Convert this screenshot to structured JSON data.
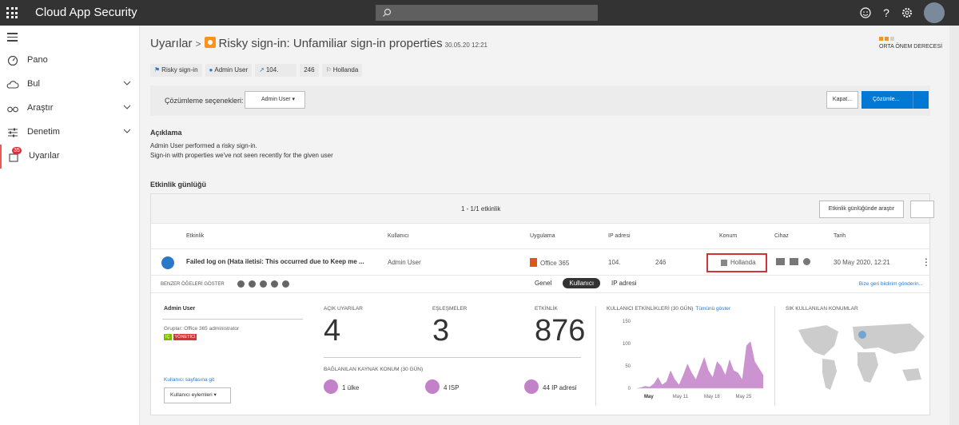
{
  "app": {
    "title": "Cloud App Security"
  },
  "sidebar": {
    "items": [
      {
        "label": "Pano"
      },
      {
        "label": "Bul"
      },
      {
        "label": "Araştır"
      },
      {
        "label": "Denetim"
      },
      {
        "label": "Uyarılar",
        "badge": "35"
      }
    ]
  },
  "header": {
    "breadcrumb": "Uyarılar",
    "title": "Risky sign-in: Unfamiliar sign-in properties",
    "time": "30.05.20 12:21",
    "severity": "ORTA ÖNEM DERECESİ"
  },
  "chips": [
    {
      "text": "Risky sign-in"
    },
    {
      "text": "Admin User"
    },
    {
      "text": "104."
    },
    {
      "text": "246"
    },
    {
      "text": "Hollanda"
    }
  ],
  "resolve": {
    "label": "Çözümleme seçenekleri:",
    "user_select": "Admin User",
    "close": "Kapat...",
    "resolve": "Çözümle..."
  },
  "description": {
    "heading": "Açıklama",
    "line1": "Admin User performed a risky sign-in.",
    "line2": "Sign-in with properties we've not seen recently for the given user"
  },
  "log": {
    "heading": "Etkinlik günlüğü",
    "count": "1 - 1/1 etkinlik",
    "investigate": "Etkinlik günlüğünde araştır",
    "columns": [
      "Etkinlik",
      "Kullanıcı",
      "Uygulama",
      "IP adresi",
      "Konum",
      "Cihaz",
      "Tarih"
    ],
    "row": {
      "activity": "Failed log on (Hata iletisi: This occurred due to Keep me ...",
      "user": "Admin User",
      "app": "Office 365",
      "ip1": "104.",
      "ip2": "246",
      "location": "Hollanda",
      "date": "30 May 2020, 12:21"
    }
  },
  "detail": {
    "similar_label": "BENZER ÖĞELERİ GÖSTER",
    "tabs": [
      "Genel",
      "Kullanıcı",
      "IP adresi"
    ],
    "feedback": "Bize geri bildirim gönderin...",
    "user_name": "Admin User",
    "groups": "Gruplar: Office 365 administrator",
    "tag_internal": "İÇ",
    "tag_admin": "YÖNETİCİ",
    "user_page_link": "Kullanıcı sayfasına git",
    "user_actions": "Kullanıcı eylemleri",
    "open_alerts_label": "AÇIK UYARILAR",
    "open_alerts": "4",
    "matches_label": "EŞLEŞMELER",
    "matches": "3",
    "activity_label": "ETKİNLİK",
    "activity": "876",
    "sources_label": "BAĞLANILAN KAYNAK KONUM (30 GÜN)",
    "countries": "1 ülke",
    "isp": "4 ISP",
    "ips": "44 IP adresi",
    "user_activity_label": "KULLANICI ETKİNLİKLERİ (30 GÜN)",
    "show_all": "Tümünü göster",
    "frequent_locations_label": "SIK KULLANILAN KONUMLAR"
  },
  "chart_data": {
    "type": "area",
    "title": "KULLANICI ETKİNLİKLERİ (30 GÜN)",
    "x_ticks": [
      "May",
      "May 11",
      "May 18",
      "May 25"
    ],
    "y_ticks": [
      0,
      50,
      100,
      150
    ],
    "ylim": [
      0,
      150
    ],
    "values": [
      0,
      2,
      5,
      3,
      10,
      25,
      8,
      15,
      40,
      20,
      8,
      30,
      55,
      35,
      20,
      45,
      70,
      40,
      25,
      60,
      50,
      30,
      65,
      40,
      35,
      20,
      95,
      105,
      60,
      45,
      30
    ]
  },
  "colors": {
    "accent": "#0078d4",
    "series": "#c281c9",
    "severity": "#f7931e",
    "alert_border": "#d13438"
  }
}
